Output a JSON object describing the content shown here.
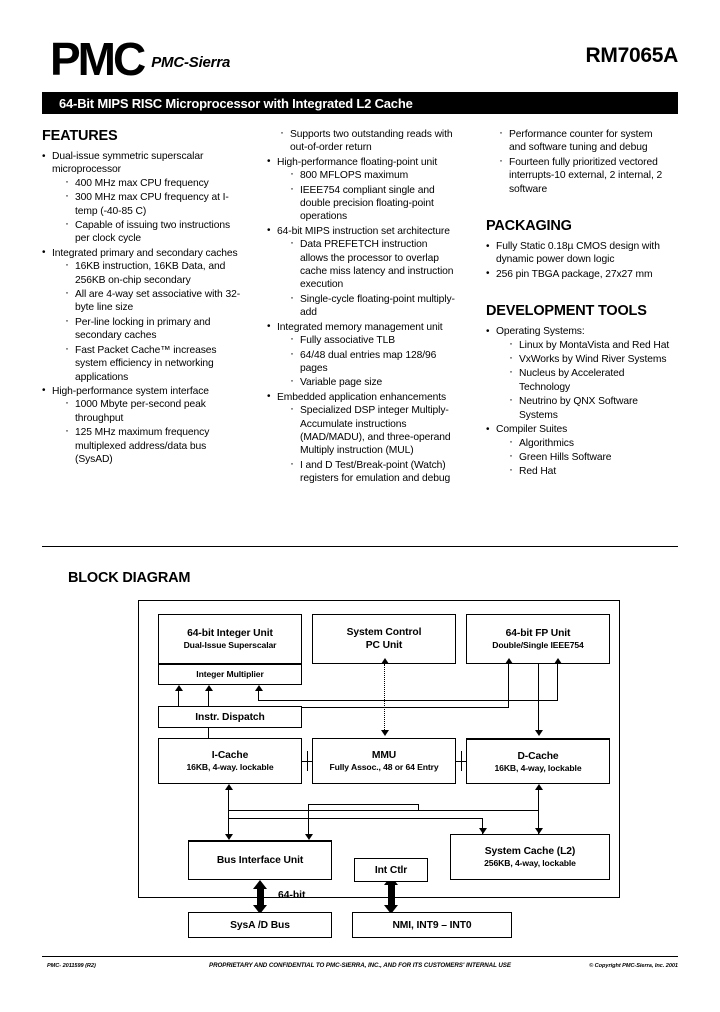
{
  "header": {
    "logo_text": "PMC",
    "logo_subtext": "PMC-Sierra",
    "part_number": "RM7065A",
    "title_bar": "64-Bit MIPS RISC Microprocessor with Integrated L2 Cache"
  },
  "sections": {
    "features_heading": "FEATURES",
    "packaging_heading": "PACKAGING",
    "development_tools_heading": "DEVELOPMENT TOOLS",
    "block_diagram_heading": "BLOCK DIAGRAM"
  },
  "features_col1": [
    {
      "text": "Dual-issue symmetric superscalar microprocessor",
      "sub": [
        "400 MHz max CPU frequency",
        "300 MHz max CPU frequency at I-temp (-40-85 C)",
        "Capable of issuing two instructions per clock cycle"
      ]
    },
    {
      "text": "Integrated primary and secondary caches",
      "sub": [
        "16KB instruction, 16KB Data, and 256KB on-chip secondary",
        "All are 4-way set associative with 32-byte line size",
        "Per-line locking in primary and secondary caches",
        "Fast Packet Cache™ increases system efficiency in networking applications"
      ]
    },
    {
      "text": "High-performance system interface",
      "sub": [
        "1000 Mbyte per-second peak throughput",
        "125 MHz maximum frequency multiplexed address/data bus (SysAD)"
      ]
    }
  ],
  "features_col2_orphan_sub": [
    "Supports two outstanding reads with out-of-order return"
  ],
  "features_col2": [
    {
      "text": "High-performance floating-point unit",
      "sub": [
        "800 MFLOPS maximum",
        "IEEE754 compliant single and double precision floating-point operations"
      ]
    },
    {
      "text": "64-bit MIPS instruction set architecture",
      "sub": [
        "Data PREFETCH instruction allows the processor to overlap cache miss latency and instruction execution",
        "Single-cycle floating-point multiply-add"
      ]
    },
    {
      "text": "Integrated memory management unit",
      "sub": [
        "Fully associative TLB",
        "64/48 dual entries map 128/96 pages",
        "Variable page size"
      ]
    },
    {
      "text": "Embedded application enhancements",
      "sub": [
        "Specialized DSP integer Multiply-Accumulate instructions (MAD/MADU), and three-operand Multiply instruction (MUL)",
        "I and D Test/Break-point (Watch) registers for emulation and debug"
      ]
    }
  ],
  "features_col3_orphan_sub": [
    "Performance counter for system and software tuning and debug",
    "Fourteen fully prioritized vectored interrupts-10 external, 2 internal, 2 software"
  ],
  "packaging": [
    "Fully Static 0.18µ CMOS design with dynamic power down logic",
    "256 pin TBGA package, 27x27 mm"
  ],
  "development_tools": [
    {
      "text": "Operating Systems:",
      "sub": [
        "Linux by MontaVista and Red Hat",
        "VxWorks by Wind River Systems",
        "Nucleus by Accelerated Technology",
        "Neutrino by QNX Software Systems"
      ]
    },
    {
      "text": "Compiler Suites",
      "sub": [
        "Algorithmics",
        "Green Hills Software",
        "Red Hat"
      ]
    }
  ],
  "block_diagram": {
    "integer_unit": {
      "title": "64-bit Integer Unit",
      "subtitle": "Dual-Issue Superscalar"
    },
    "integer_multiplier": {
      "title": "Integer Multiplier"
    },
    "system_control": {
      "title": "System Control",
      "subtitle": "PC Unit"
    },
    "fp_unit": {
      "title": "64-bit FP Unit",
      "subtitle": "Double/Single IEEE754"
    },
    "instr_dispatch": {
      "title": "Instr. Dispatch"
    },
    "icache": {
      "title": "I-Cache",
      "subtitle": "16KB, 4-way. lockable"
    },
    "mmu": {
      "title": "MMU",
      "subtitle": "Fully Assoc., 48 or 64 Entry"
    },
    "dcache": {
      "title": "D-Cache",
      "subtitle": "16KB, 4-way, lockable"
    },
    "biu": {
      "title": "Bus Interface Unit"
    },
    "int_ctlr": {
      "title": "Int Ctlr"
    },
    "system_cache": {
      "title": "System Cache (L2)",
      "subtitle": "256KB, 4-way, lockable"
    },
    "sysad_bus": {
      "title": "SysA /D Bus"
    },
    "nmi_bus": {
      "title": "NMI, INT9 – INT0"
    },
    "bus_width_label": "64-bit"
  },
  "footer": {
    "doc_number": "PMC- 2011599 (R2)",
    "confidential": "PROPRIETARY AND CONFIDENTIAL TO PMC-SIERRA, INC., AND FOR ITS CUSTOMERS' INTERNAL USE",
    "copyright": "© Copyright PMC-Sierra, Inc. 2001"
  }
}
